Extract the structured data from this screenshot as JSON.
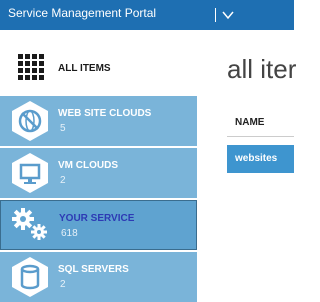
{
  "header": {
    "title": "Service Management Portal",
    "menu_icon": "chevron-down-icon"
  },
  "sidebar": {
    "items": [
      {
        "label": "ALL ITEMS",
        "icon": "grid-icon"
      },
      {
        "label": "WEB SITE CLOUDS",
        "count": "5",
        "icon": "globe-icon"
      },
      {
        "label": "VM CLOUDS",
        "count": "2",
        "icon": "monitor-icon"
      },
      {
        "label": "YOUR SERVICE",
        "count": "618",
        "icon": "gears-icon",
        "selected": true
      },
      {
        "label": "SQL SERVERS",
        "count": "2",
        "icon": "database-icon"
      }
    ]
  },
  "main": {
    "title": "all iter",
    "column_header": "NAME",
    "rows": [
      {
        "name": "websites",
        "selected": true
      }
    ]
  },
  "colors": {
    "topbar": "#1e6fb2",
    "sidebar_item": "#7ab4d9",
    "selected_label": "#2d3ab4",
    "selected_row": "#3e95cf"
  }
}
